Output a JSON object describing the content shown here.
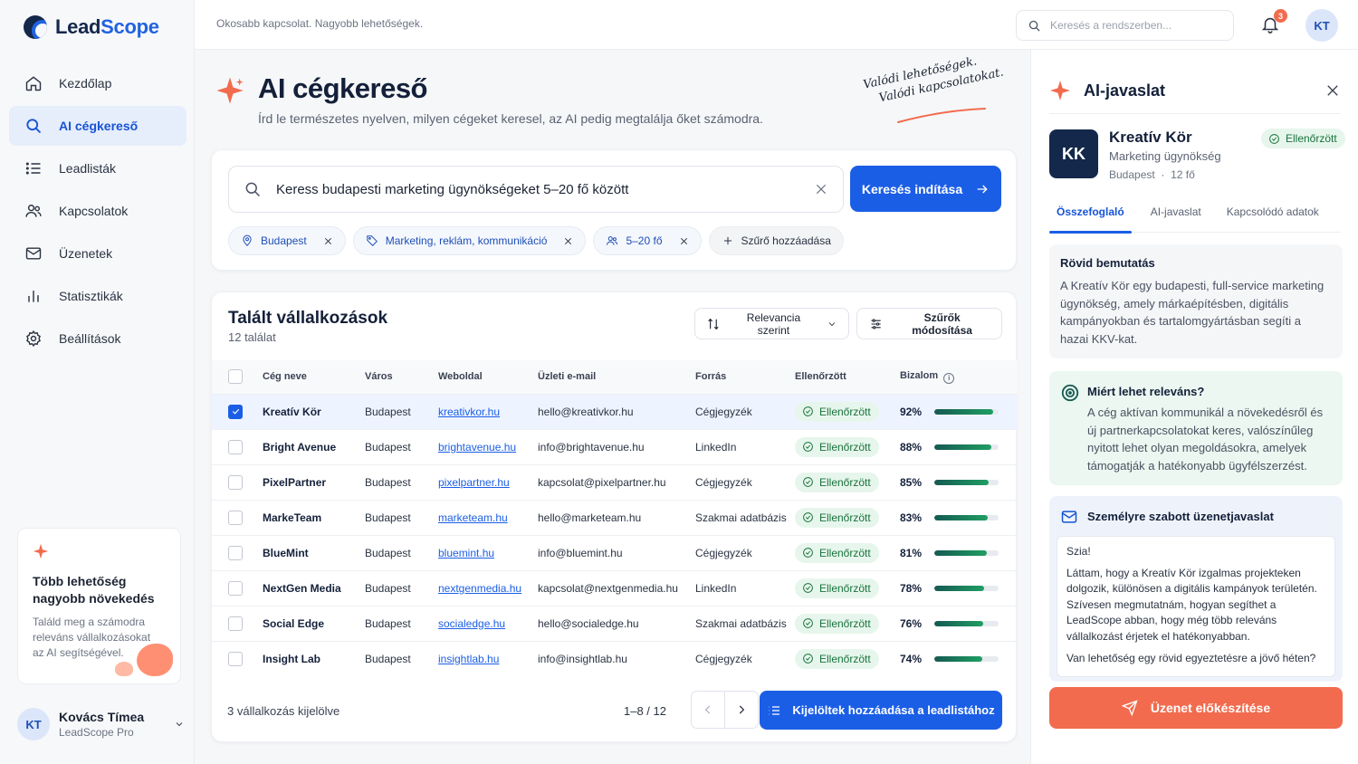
{
  "app": {
    "name_part1": "Lead",
    "name_part2": "Scope",
    "tagline": "Okosabb kapcsolat. Nagyobb lehetőségek."
  },
  "colors": {
    "primary": "#1b5ee6",
    "accent": "#f26b4e",
    "success": "#18723c",
    "navy": "#14284b"
  },
  "nav": {
    "items": [
      {
        "label": "Kezdőlap",
        "icon": "home-icon"
      },
      {
        "label": "AI cégkereső",
        "icon": "search-icon"
      },
      {
        "label": "Leadlisták",
        "icon": "list-icon"
      },
      {
        "label": "Kapcsolatok",
        "icon": "users-icon"
      },
      {
        "label": "Üzenetek",
        "icon": "mail-icon"
      },
      {
        "label": "Statisztikák",
        "icon": "bar-chart-icon"
      },
      {
        "label": "Beállítások",
        "icon": "gear-icon"
      }
    ],
    "active": 1
  },
  "promo": {
    "title": "Több lehetőség nagyobb növekedés",
    "text": "Találd meg a számodra releváns vállalkozásokat az AI segítségével."
  },
  "user": {
    "initials": "KT",
    "name": "Kovács Tímea",
    "plan": "LeadScope Pro"
  },
  "topbar": {
    "search_placeholder": "Keresés a rendszerben...",
    "notifications": "3",
    "avatar": "KT"
  },
  "header": {
    "title": "AI cégkereső",
    "subtitle": "Írd le természetes nyelven, milyen cégeket keresel, az AI pedig megtalálja őket számodra.",
    "handwritten_line1": "Valódi lehetőségek.",
    "handwritten_line2": "Valódi kapcsolatokat."
  },
  "search": {
    "query": "Keress budapesti marketing ügynökségeket 5–20 fő között",
    "button": "Keresés indítása",
    "chips": [
      {
        "label": "Budapest",
        "icon": "map-pin-icon"
      },
      {
        "label": "Marketing, reklám, kommunikáció",
        "icon": "tag-icon"
      },
      {
        "label": "5–20 fő",
        "icon": "users-icon"
      }
    ],
    "add_filter": "Szűrő hozzáadása"
  },
  "results": {
    "title": "Talált vállalkozások",
    "count": "12 találat",
    "sort_label": "Relevancia szerint",
    "filter_label": "Szűrők módosítása",
    "columns": [
      "Cég neve",
      "Város",
      "Weboldal",
      "Üzleti e-mail",
      "Forrás",
      "Ellenőrzött",
      "Bizalom"
    ],
    "verified_label": "Ellenőrzött",
    "rows": [
      {
        "name": "Kreatív Kör",
        "city": "Budapest",
        "web": "kreativkor.hu",
        "email": "hello@kreativkor.hu",
        "source": "Cégjegyzék",
        "score": "92%",
        "score_value": 92,
        "selected": true
      },
      {
        "name": "Bright Avenue",
        "city": "Budapest",
        "web": "brightavenue.hu",
        "email": "info@brightavenue.hu",
        "source": "LinkedIn",
        "score": "88%",
        "score_value": 88,
        "selected": false
      },
      {
        "name": "PixelPartner",
        "city": "Budapest",
        "web": "pixelpartner.hu",
        "email": "kapcsolat@pixelpartner.hu",
        "source": "Cégjegyzék",
        "score": "85%",
        "score_value": 85,
        "selected": false
      },
      {
        "name": "MarkeTeam",
        "city": "Budapest",
        "web": "marketeam.hu",
        "email": "hello@marketeam.hu",
        "source": "Szakmai adatbázis",
        "score": "83%",
        "score_value": 83,
        "selected": false
      },
      {
        "name": "BlueMint",
        "city": "Budapest",
        "web": "bluemint.hu",
        "email": "info@bluemint.hu",
        "source": "Cégjegyzék",
        "score": "81%",
        "score_value": 81,
        "selected": false
      },
      {
        "name": "NextGen Media",
        "city": "Budapest",
        "web": "nextgenmedia.hu",
        "email": "kapcsolat@nextgenmedia.hu",
        "source": "LinkedIn",
        "score": "78%",
        "score_value": 78,
        "selected": false
      },
      {
        "name": "Social Edge",
        "city": "Budapest",
        "web": "socialedge.hu",
        "email": "hello@socialedge.hu",
        "source": "Szakmai adatbázis",
        "score": "76%",
        "score_value": 76,
        "selected": false
      },
      {
        "name": "Insight Lab",
        "city": "Budapest",
        "web": "insightlab.hu",
        "email": "info@insightlab.hu",
        "source": "Cégjegyzék",
        "score": "74%",
        "score_value": 74,
        "selected": false
      }
    ],
    "selected_text": "3 vállalkozás kijelölve",
    "pager": "1–8 / 12",
    "add_button": "Kijelöltek hozzáadása a leadlistához"
  },
  "panel": {
    "title": "AI-javaslat",
    "company": {
      "initials": "KK",
      "name": "Kreatív Kör",
      "type": "Marketing ügynökség",
      "city": "Budapest",
      "size": "12 fő",
      "badge": "Ellenőrzött"
    },
    "tabs": [
      "Összefoglaló",
      "AI-javaslat",
      "Kapcsolódó adatok"
    ],
    "active_tab": 0,
    "summary_title": "Rövid bemutatás",
    "summary_text": "A Kreatív Kör egy budapesti, full-service marketing ügynökség, amely márkaépítésben, digitális kampányokban és tartalomgyártásban segíti a hazai KKV-kat.",
    "why_title": "Miért lehet releváns?",
    "why_text": "A cég aktívan kommunikál a növekedésről és új partnerkapcsolatokat keres, valószínűleg nyitott lehet olyan megoldásokra, amelyek támogatják a hatékonyabb ügyfélszerzést.",
    "msg_title": "Személyre szabott üzenetjavaslat",
    "msg_greeting": "Szia!",
    "msg_body": "Láttam, hogy a Kreatív Kör izgalmas projekteken dolgozik, különösen a digitális kampányok területén. Szívesen megmutatnám, hogyan segíthet a LeadScope abban, hogy még több releváns vállalkozást érjetek el hatékonyabban.",
    "msg_question": "Van lehetőség egy rövid egyeztetésre a jövő héten?",
    "send_button": "Üzenet előkészítése"
  }
}
